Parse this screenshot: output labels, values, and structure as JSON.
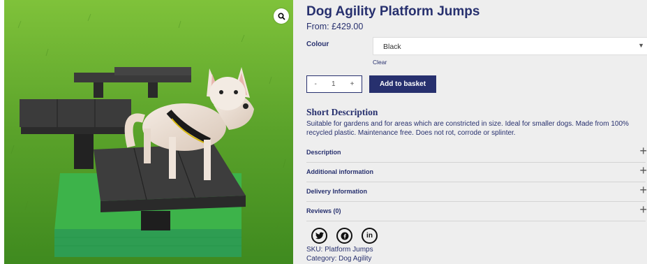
{
  "product": {
    "title": "Dog Agility Platform Jumps",
    "price": "From: £429.00",
    "image_alt": "Small dog standing on recycled plastic agility platform steps on grass"
  },
  "variation": {
    "label": "Colour",
    "selected": "Black",
    "clear": "Clear"
  },
  "cart": {
    "minus": "-",
    "quantity": "1",
    "plus": "+",
    "add_label": "Add to basket"
  },
  "short_description": {
    "heading": "Short Description",
    "text": "Suitable for gardens and for areas which are constricted in size. Ideal for smaller dogs.   Made from 100% recycled plastic. Maintenance free. Does not rot, corrode or splinter."
  },
  "accordion": [
    {
      "label": "Description",
      "toggle": "+"
    },
    {
      "label": "Additional information",
      "toggle": "+"
    },
    {
      "label": "Delivery Information",
      "toggle": "+"
    },
    {
      "label": "Reviews (0)",
      "toggle": "+"
    }
  ],
  "social": [
    "twitter-icon",
    "facebook-icon",
    "linkedin-icon"
  ],
  "meta": {
    "sku_label": "SKU:",
    "sku": "Platform Jumps",
    "category_label": "Category:",
    "category": "Dog Agility"
  },
  "colors": {
    "brand": "#27306e",
    "panel": "#eeeeee"
  }
}
